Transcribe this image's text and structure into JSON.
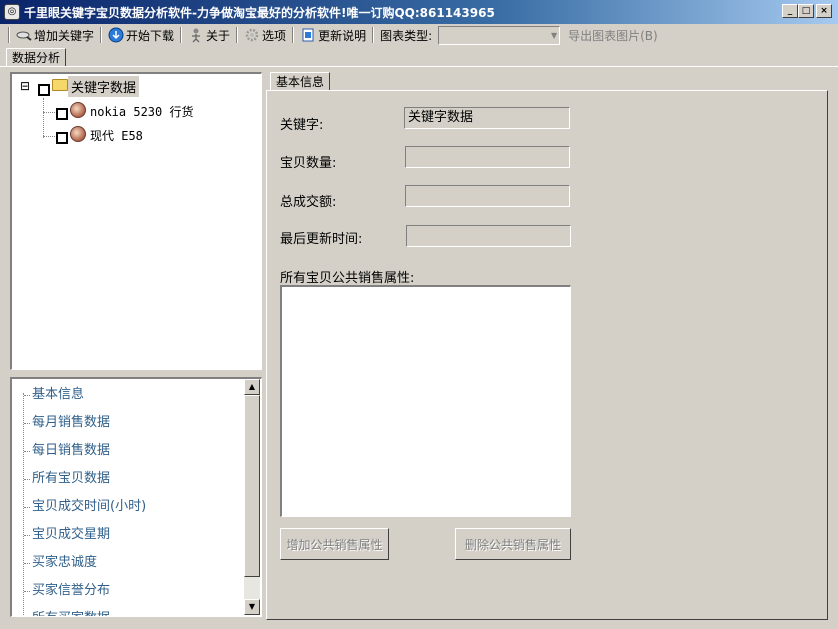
{
  "window": {
    "title": "千里眼关键字宝贝数据分析软件-力争做淘宝最好的分析软件!唯一订购QQ:861143965",
    "controls": [
      "_",
      "□",
      "×"
    ]
  },
  "toolbar": {
    "add_keyword": "增加关键字",
    "start_download": "开始下载",
    "about": "关于",
    "options": "选项",
    "update_notes": "更新说明",
    "chart_type_label": "图表类型:",
    "chart_type_value": "",
    "export_chart": "导出图表图片(B)"
  },
  "tabs": {
    "data_analysis": "数据分析",
    "basic_info": "基本信息"
  },
  "tree": {
    "collapse_symbol": "⊟",
    "root_label": "关键字数据",
    "children": [
      "nokia 5230 行货",
      "现代 E58"
    ]
  },
  "nav": {
    "items": [
      "基本信息",
      "每月销售数据",
      "每日销售数据",
      "所有宝贝数据",
      "宝贝成交时间(小时)",
      "宝贝成交星期",
      "买家忠诚度",
      "买家信誉分布",
      "所有买家数据"
    ]
  },
  "form": {
    "keyword_label": "关键字:",
    "keyword_value": "关键字数据",
    "count_label": "宝贝数量:",
    "count_value": "",
    "total_label": "总成交额:",
    "total_value": "",
    "updated_label": "最后更新时间:",
    "updated_value": "",
    "attrs_label": "所有宝贝公共销售属性:",
    "add_attr_button": "增加公共销售属性",
    "remove_attr_button": "删除公共销售属性"
  }
}
